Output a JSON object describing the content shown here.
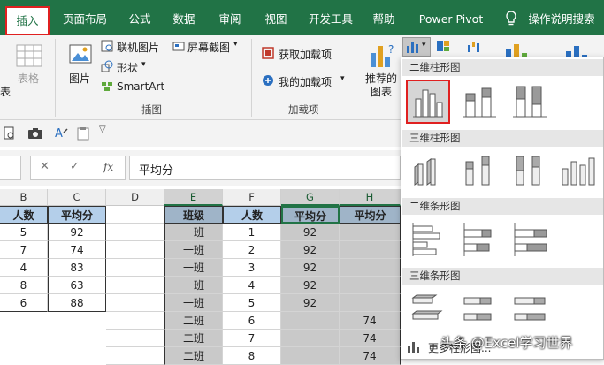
{
  "tabs": [
    "插入",
    "页面布局",
    "公式",
    "数据",
    "审阅",
    "视图",
    "开发工具",
    "帮助",
    "Power Pivot",
    "操作说明搜索"
  ],
  "ribbon": {
    "table_label": "表格",
    "table_small": "表",
    "picture_label": "图片",
    "online_picture": "联机图片",
    "shapes": "形状",
    "smartart": "SmartArt",
    "screenshot": "屏幕截图",
    "illustrations_group": "插图",
    "get_addins": "获取加载项",
    "my_addins": "我的加载项",
    "addins_group": "加载项",
    "recommended_charts_1": "推荐的",
    "recommended_charts_2": "图表"
  },
  "formula_bar": {
    "fx": "fx",
    "value": "平均分"
  },
  "columns": [
    "B",
    "C",
    "D",
    "E",
    "F",
    "G",
    "H"
  ],
  "left_table": {
    "headers": [
      "人数",
      "平均分"
    ],
    "rows": [
      [
        "5",
        "92"
      ],
      [
        "7",
        "74"
      ],
      [
        "4",
        "83"
      ],
      [
        "8",
        "63"
      ],
      [
        "6",
        "88"
      ]
    ]
  },
  "right_table": {
    "headers": [
      "班级",
      "人数",
      "平均分",
      "平均分"
    ],
    "rows": [
      [
        "一班",
        "1",
        "92",
        ""
      ],
      [
        "一班",
        "2",
        "92",
        ""
      ],
      [
        "一班",
        "3",
        "92",
        ""
      ],
      [
        "一班",
        "4",
        "92",
        ""
      ],
      [
        "一班",
        "5",
        "92",
        ""
      ],
      [
        "二班",
        "6",
        "",
        "74"
      ],
      [
        "二班",
        "7",
        "",
        "74"
      ],
      [
        "二班",
        "8",
        "",
        "74"
      ]
    ]
  },
  "chart_menu": {
    "section_2d_column": "二维柱形图",
    "section_3d_column": "三维柱形图",
    "section_2d_bar": "二维条形图",
    "section_3d_bar": "三维条形图",
    "more_charts": "更多柱形图..."
  },
  "watermark": "头条 @Excel学习世界",
  "colors": {
    "excel_green": "#217346",
    "highlight_red": "#e02020",
    "header_blue": "#b4cfea",
    "selection_gray": "#c9c9c9"
  }
}
